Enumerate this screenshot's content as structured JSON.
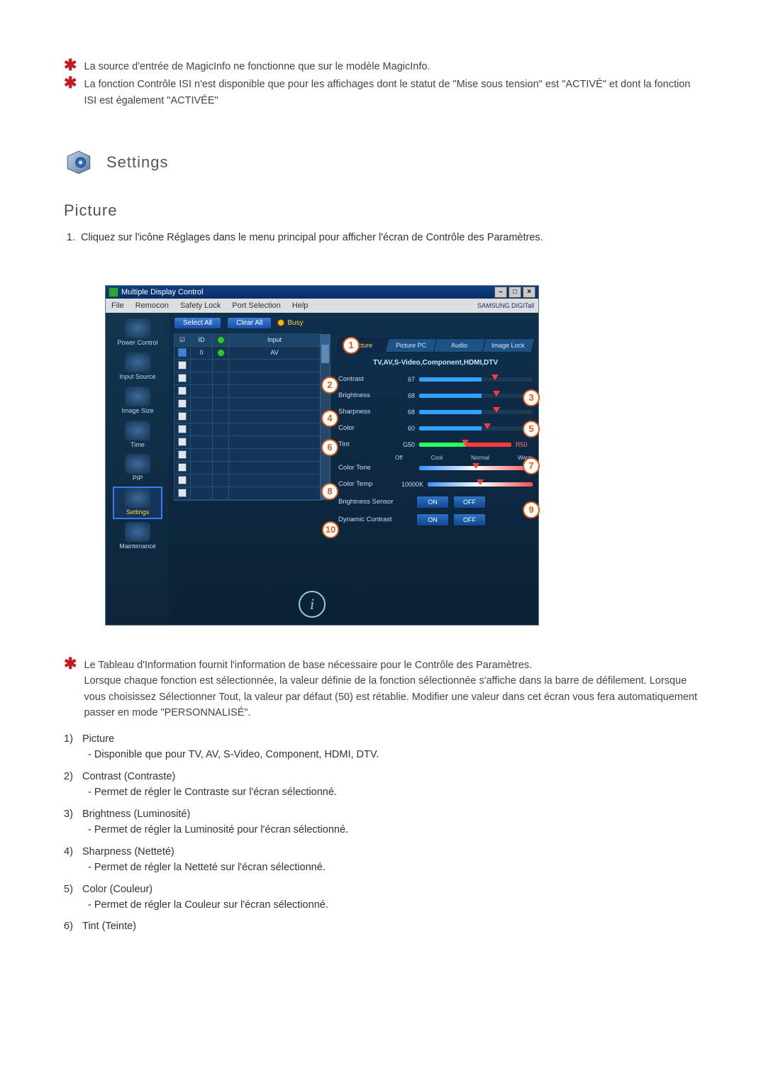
{
  "doc": {
    "bullets": [
      "La source d'entrée de MagicInfo ne fonctionne que sur le modèle MagicInfo.",
      "La fonction Contrôle ISI n'est disponible que pour les affichages dont le statut de \"Mise sous tension\" est \"ACTIVÉ\" et dont la fonction ISI est également \"ACTIVÉE\""
    ],
    "settings_title": "Settings",
    "picture_title": "Picture",
    "intro": "Cliquez sur l'icône Réglages dans le menu principal pour afficher l'écran de Contrôle des Paramètres.",
    "after_star": "Le Tableau d'Information fournit l'information de base nécessaire pour le Contrôle des Paramètres.",
    "after_para": "Lorsque chaque fonction est sélectionnée, la valeur définie de la fonction sélectionnée s'affiche dans la barre de défilement. Lorsque vous choisissez Sélectionner Tout, la valeur par défaut (50) est rétablie. Modifier une valeur dans cet écran vous fera automatiquement passer en mode \"PERSONNALISÉ\".",
    "items": [
      {
        "n": "1)",
        "title": "Picture",
        "desc": "- Disponible que pour TV, AV, S-Video, Component, HDMI, DTV."
      },
      {
        "n": "2)",
        "title": "Contrast (Contraste)",
        "desc": "- Permet de régler le Contraste sur l'écran sélectionné."
      },
      {
        "n": "3)",
        "title": "Brightness (Luminosité)",
        "desc": "- Permet de régler la Luminosité pour l'écran sélectionné."
      },
      {
        "n": "4)",
        "title": "Sharpness (Netteté)",
        "desc": "- Permet de régler la Netteté sur l'écran sélectionné."
      },
      {
        "n": "5)",
        "title": "Color (Couleur)",
        "desc": "- Permet de régler la Couleur sur l'écran sélectionné."
      },
      {
        "n": "6)",
        "title": "Tint (Teinte)",
        "desc": ""
      }
    ]
  },
  "app": {
    "window_title": "Multiple Display Control",
    "brand": "SAMSUNG DIGITall",
    "menu": [
      "File",
      "Remocon",
      "Safety Lock",
      "Port Selection",
      "Help"
    ],
    "sidebar": [
      {
        "label": "Power Control"
      },
      {
        "label": "Input Source"
      },
      {
        "label": "Image Size"
      },
      {
        "label": "Time"
      },
      {
        "label": "PIP"
      },
      {
        "label": "Settings"
      },
      {
        "label": "Maintenance"
      }
    ],
    "select_all": "Select All",
    "clear_all": "Clear All",
    "busy": "Busy",
    "table": {
      "headers": {
        "chk": "☑",
        "id": "ID",
        "status": "●",
        "input": "Input"
      },
      "row": {
        "id": "0",
        "input": "AV"
      },
      "empty_rows": 11
    },
    "tabs": [
      "Picture",
      "Picture PC",
      "Audio",
      "Image Lock"
    ],
    "legend": "TV,AV,S-Video,Component,HDMI,DTV",
    "controls": {
      "contrast": {
        "label": "Contrast",
        "value": "67"
      },
      "brightness": {
        "label": "Brightness",
        "value": "68"
      },
      "sharpness": {
        "label": "Sharpness",
        "value": "68"
      },
      "color": {
        "label": "Color",
        "value": "60"
      },
      "tint": {
        "label": "Tint",
        "g": "G50",
        "r": "R50"
      },
      "colortone": {
        "label": "Color Tone",
        "opts": [
          "Off",
          "Cool",
          "Normal",
          "Warm"
        ]
      },
      "colortemp": {
        "label": "Color Temp",
        "value": "10000K"
      },
      "brightsensor": {
        "label": "Brightness Sensor",
        "on": "ON",
        "off": "OFF"
      },
      "dyncontrast": {
        "label": "Dynamic Contrast",
        "on": "ON",
        "off": "OFF"
      }
    },
    "callouts": [
      "1",
      "2",
      "3",
      "4",
      "5",
      "6",
      "7",
      "8",
      "9",
      "10"
    ]
  }
}
